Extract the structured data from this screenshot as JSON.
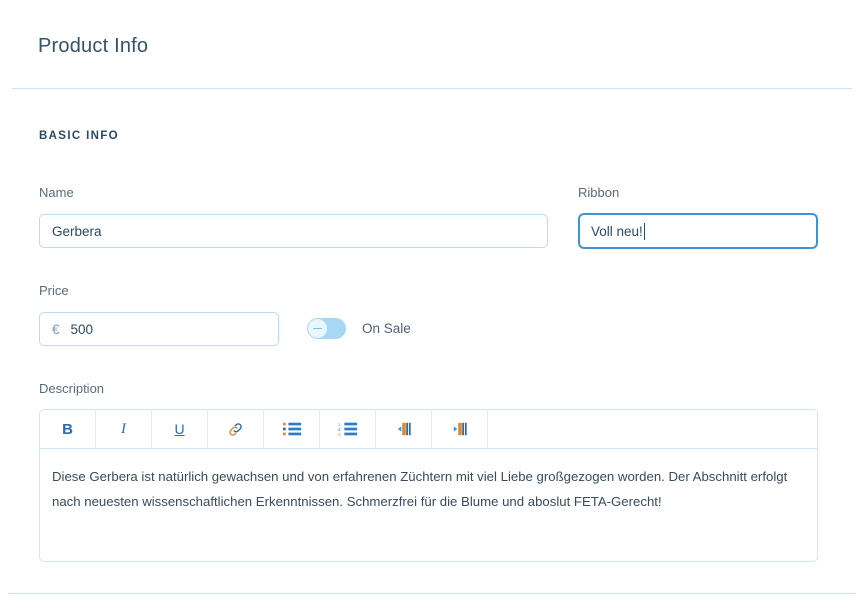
{
  "header": {
    "title": "Product Info"
  },
  "section": {
    "label": "BASIC INFO"
  },
  "fields": {
    "name": {
      "label": "Name",
      "value": "Gerbera",
      "placeholder": "Name"
    },
    "ribbon": {
      "label": "Ribbon",
      "value": "Voll neu!",
      "placeholder": "Ribbon",
      "focused": true
    },
    "price": {
      "label": "Price",
      "currency": "€",
      "value": "500",
      "placeholder": "Price"
    },
    "on_sale": {
      "label": "On Sale",
      "state": "off",
      "knob_glyph": "minus-dash"
    },
    "description": {
      "label": "Description",
      "text": "Diese Gerbera ist natürlich gewachsen und von erfahrenen Züchtern mit viel Liebe großgezogen worden. Der Abschnitt erfolgt nach neuesten wissenschaftlichen Erkenntnissen. Schmerzfrei für die Blume und aboslut FETA-Gerecht!"
    }
  },
  "editor_toolbar": {
    "buttons": [
      {
        "name": "bold",
        "label": "B"
      },
      {
        "name": "italic",
        "label": "I"
      },
      {
        "name": "underline",
        "label": "U"
      },
      {
        "name": "link",
        "label": "link-icon"
      },
      {
        "name": "unordered-list",
        "label": "bullet-list-icon"
      },
      {
        "name": "ordered-list",
        "label": "numbered-list-icon"
      },
      {
        "name": "direction-rtl",
        "label": "paragraph-rtl-icon"
      },
      {
        "name": "direction-ltr",
        "label": "paragraph-ltr-icon"
      }
    ]
  },
  "colors": {
    "accent": "#3d95d8",
    "border": "#b8dcf2",
    "divider": "#cfe4f3",
    "text": "#2b4a63",
    "toolbar_icon": "#2b6cb0",
    "toggle_track": "#a6d8f4"
  }
}
